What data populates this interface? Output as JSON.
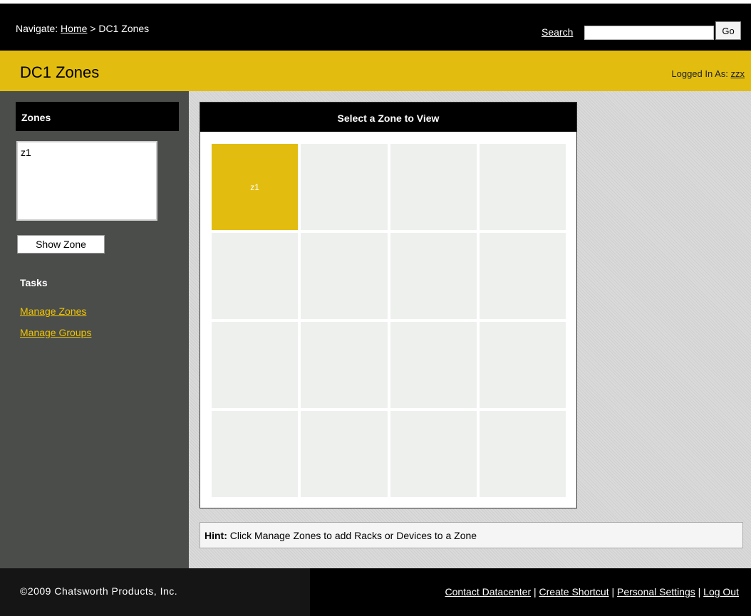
{
  "header": {
    "nav_prefix": "Navigate: ",
    "nav_home": "Home",
    "nav_separator": " > ",
    "nav_current": "DC1 Zones",
    "search_label": "Search",
    "search_value": "",
    "go_label": "Go"
  },
  "title_bar": {
    "title": "DC1 Zones",
    "logged_in_label": "Logged In As: ",
    "user": "zzx"
  },
  "sidebar": {
    "zones_heading": "Zones",
    "zones_list": [
      "z1"
    ],
    "show_zone_label": "Show Zone",
    "tasks_heading": "Tasks",
    "tasks": [
      "Manage Zones",
      "Manage Groups"
    ]
  },
  "main": {
    "panel_title": "Select a Zone to View",
    "zone_tile": "z1",
    "hint_label": "Hint:",
    "hint_text": " Click Manage Zones to add Racks or Devices to a Zone"
  },
  "footer": {
    "copyright": "©2009 Chatsworth Products, Inc.",
    "links": [
      "Contact Datacenter",
      "Create Shortcut",
      "Personal Settings",
      "Log Out"
    ],
    "separator": " | "
  },
  "colors": {
    "accent_yellow": "#e2bd10",
    "sidebar_bg": "#4b4d4b",
    "bar_black": "#000000"
  }
}
